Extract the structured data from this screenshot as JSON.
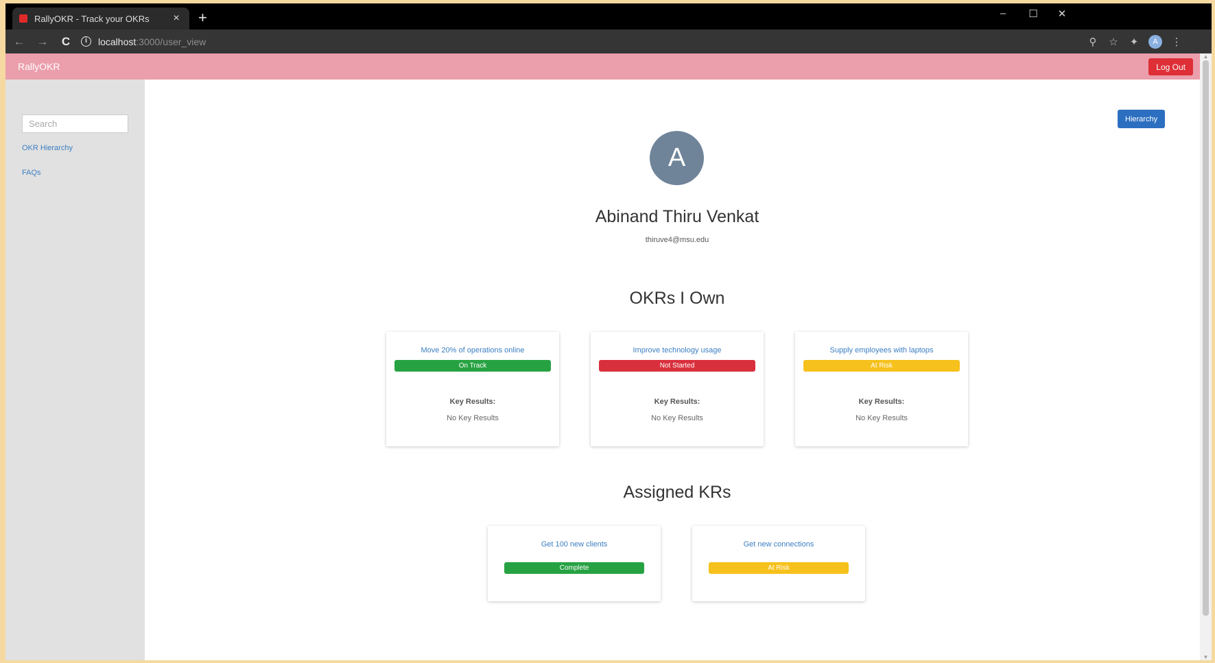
{
  "browser": {
    "tab_title": "RallyOKR - Track your OKRs",
    "tab_close": "×",
    "new_tab": "+",
    "url_host": "localhost",
    "url_path": ":3000/user_view",
    "window_controls": {
      "minimize": "–",
      "maximize": "☐",
      "close": "✕"
    },
    "nav": {
      "back": "←",
      "forward": "→",
      "reload": "C"
    },
    "profile_initial": "A"
  },
  "app": {
    "brand": "RallyOKR",
    "logout_label": "Log Out",
    "hierarchy_label": "Hierarchy"
  },
  "sidebar": {
    "search_placeholder": "Search",
    "links": [
      "OKR Hierarchy",
      "FAQs"
    ]
  },
  "profile": {
    "initial": "A",
    "name": "Abinand Thiru Venkat",
    "email": "thiruve4@msu.edu"
  },
  "okrs_section": {
    "title": "OKRs I Own",
    "cards": [
      {
        "title": "Move 20% of operations online",
        "status": "On Track",
        "status_color": "#27a243",
        "kr_label": "Key Results:",
        "kr_value": "No Key Results"
      },
      {
        "title": "Improve technology usage",
        "status": "Not Started",
        "status_color": "#d9303d",
        "kr_label": "Key Results:",
        "kr_value": "No Key Results"
      },
      {
        "title": "Supply employees with laptops",
        "status": "At Risk",
        "status_color": "#f6c11c",
        "kr_label": "Key Results:",
        "kr_value": "No Key Results"
      }
    ]
  },
  "krs_section": {
    "title": "Assigned KRs",
    "cards": [
      {
        "title": "Get 100 new clients",
        "status": "Complete",
        "status_color": "#27a243"
      },
      {
        "title": "Get new connections",
        "status": "At Risk",
        "status_color": "#f6c11c"
      }
    ]
  }
}
